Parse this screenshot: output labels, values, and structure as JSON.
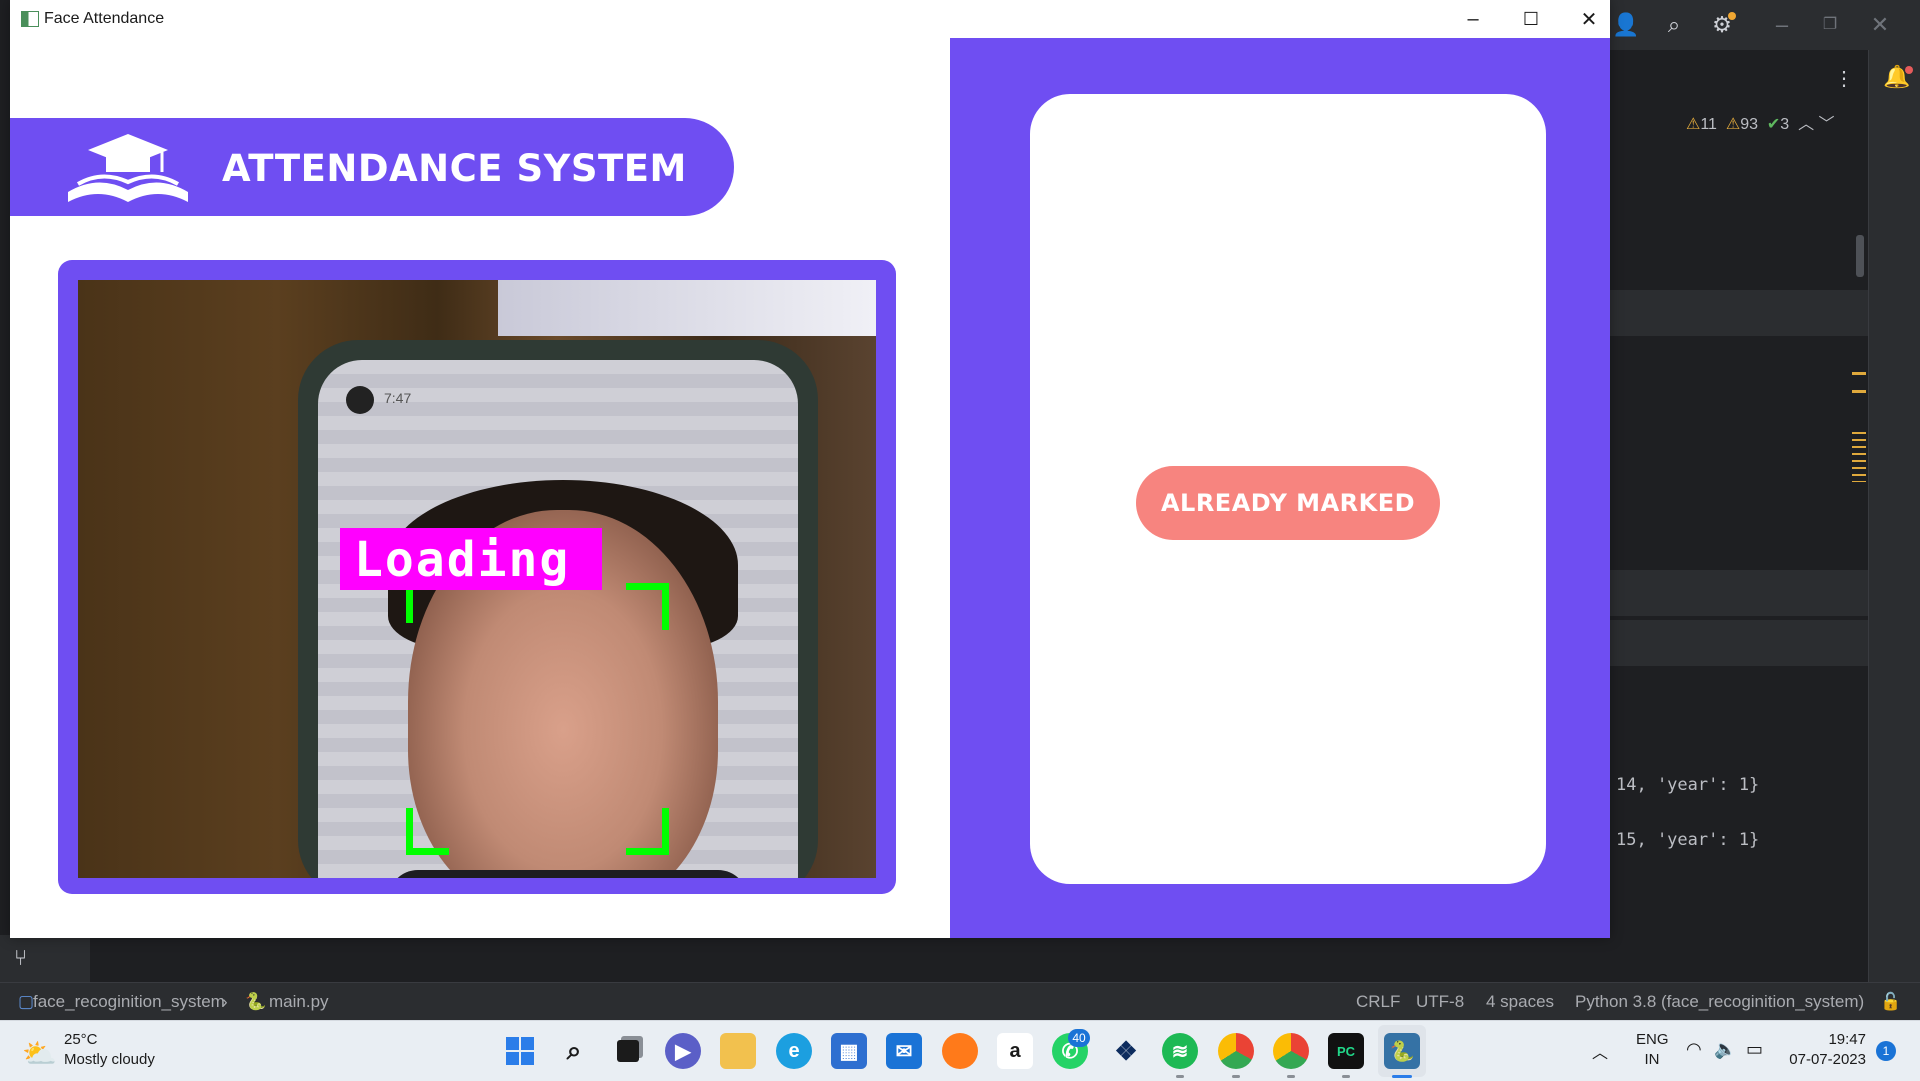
{
  "window": {
    "title": "Face Attendance",
    "controls": {
      "minimize": "–",
      "maximize": "☐",
      "close": "✕"
    }
  },
  "app": {
    "banner_title": "ATTENDANCE SYSTEM",
    "camera_overlay_label": "Loading",
    "status_button": "ALREADY MARKED",
    "colors": {
      "primary": "#6f4ef2",
      "status_button": "#f7847f",
      "overlay": "#ff00ff",
      "face_box": "#00ff00"
    },
    "phone_clock": "7:47"
  },
  "ide": {
    "inspections": {
      "warnings_a": "11",
      "warnings_b": "93",
      "ok": "3"
    },
    "code_lines": [
      "14, 'year': 1}",
      "15, 'year': 1}"
    ],
    "statusbar": {
      "project": "face_recoginition_system",
      "file": "main.py",
      "line_ending": "CRLF",
      "encoding": "UTF-8",
      "indent": "4 spaces",
      "interpreter": "Python 3.8 (face_recoginition_system)"
    }
  },
  "taskbar": {
    "weather_temp": "25°C",
    "weather_desc": "Mostly cloudy",
    "whatsapp_badge": "40",
    "lang_top": "ENG",
    "lang_bottom": "IN",
    "time": "19:47",
    "date": "07-07-2023",
    "notification_count": "1"
  }
}
